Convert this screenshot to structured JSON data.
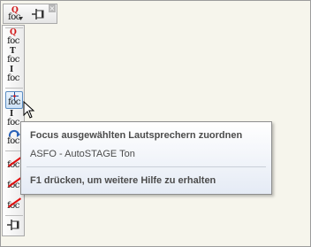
{
  "mini_toolbar": {
    "focus_button_text": "foc",
    "focus_button_mark": "Q",
    "close_glyph": "×"
  },
  "vertical_toolbar": {
    "buttons": [
      {
        "text": "foc",
        "mark": "Q",
        "mark_color": "red",
        "name": "focus-q-button",
        "icon": "foc-q-icon"
      },
      {
        "text": "foc",
        "mark": "T",
        "mark_color": "dark",
        "name": "focus-t-button",
        "icon": "foc-t-icon"
      },
      {
        "text": "foc",
        "mark": "I",
        "mark_color": "dark",
        "name": "focus-i-button",
        "icon": "foc-i-icon"
      },
      {
        "text": "foc",
        "mark": "",
        "mark_color": "dark",
        "name": "focus-selected-speakers-button",
        "icon": "foc-crosshair-icon",
        "active": true
      },
      {
        "text": "foc",
        "mark": "I",
        "mark_color": "dark",
        "name": "focus-i-arrow-button",
        "icon": "foc-i-arrow-icon"
      },
      {
        "text": "foc",
        "mark": "",
        "mark_color": "dark",
        "name": "focus-rotate-button",
        "icon": "foc-rotate-icon"
      },
      {
        "text": "foc",
        "mark": "",
        "mark_color": "red",
        "name": "focus-clear-1-button",
        "icon": "foc-clear-icon"
      },
      {
        "text": "foc",
        "mark": "",
        "mark_color": "red",
        "name": "focus-clear-2-button",
        "icon": "foc-clear-icon"
      },
      {
        "text": "foc",
        "mark": "",
        "mark_color": "red",
        "name": "focus-clear-3-button",
        "icon": "foc-clear-icon"
      }
    ]
  },
  "tooltip": {
    "title": "Focus ausgewählten Lautsprechern zuordnen",
    "subtitle": "ASFO - AutoSTAGE Ton",
    "help": "F1 drücken, um weitere Hilfe zu erhalten"
  },
  "colors": {
    "background": "#f5f4ea",
    "accent_red": "#d01818",
    "active_border": "#5b8dc2",
    "tooltip_text": "#4c4c4c"
  }
}
